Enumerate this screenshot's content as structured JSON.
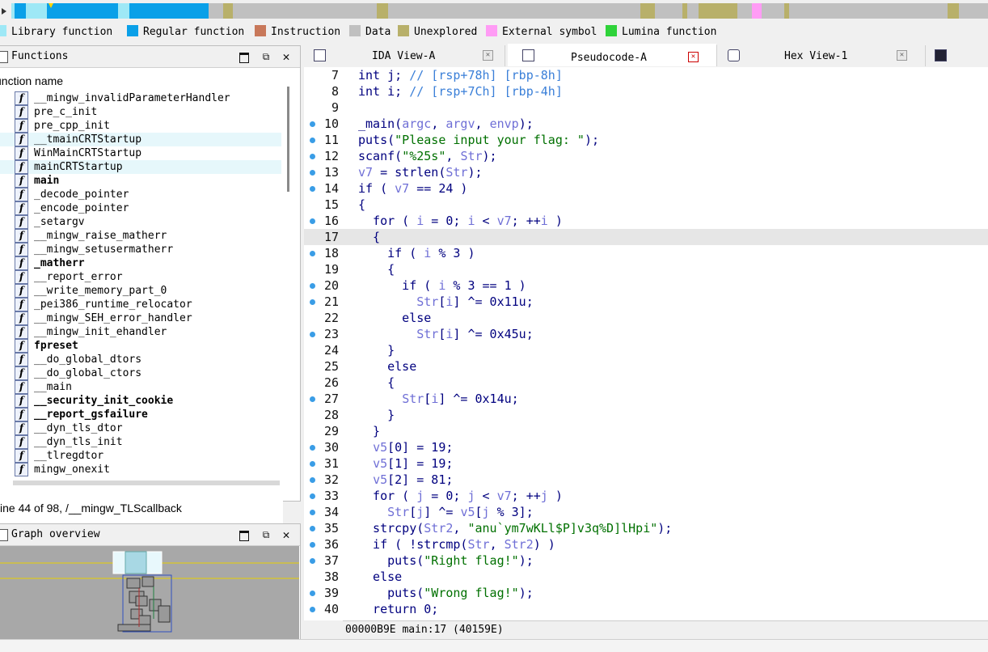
{
  "legend": [
    {
      "label": "Library function",
      "color": "#9ee8f6"
    },
    {
      "label": "Regular function",
      "color": "#0aa0e8"
    },
    {
      "label": "Instruction",
      "color": "#c8785a"
    },
    {
      "label": "Data",
      "color": "#c0c0c0"
    },
    {
      "label": "Unexplored",
      "color": "#b8b06a"
    },
    {
      "label": "External symbol",
      "color": "#ff9cf5"
    },
    {
      "label": "Lumina function",
      "color": "#2fd33a"
    }
  ],
  "functions_panel": {
    "title": "Functions",
    "column_header": "unction name",
    "items": [
      {
        "name": "__mingw_invalidParameterHandler",
        "bold": false,
        "selected": false
      },
      {
        "name": "pre_c_init",
        "bold": false,
        "selected": false
      },
      {
        "name": "pre_cpp_init",
        "bold": false,
        "selected": false
      },
      {
        "name": "__tmainCRTStartup",
        "bold": false,
        "selected": true
      },
      {
        "name": "WinMainCRTStartup",
        "bold": false,
        "selected": false
      },
      {
        "name": "mainCRTStartup",
        "bold": false,
        "selected": true
      },
      {
        "name": "main",
        "bold": true,
        "selected": false
      },
      {
        "name": "_decode_pointer",
        "bold": false,
        "selected": false
      },
      {
        "name": "_encode_pointer",
        "bold": false,
        "selected": false
      },
      {
        "name": "_setargv",
        "bold": false,
        "selected": false
      },
      {
        "name": "__mingw_raise_matherr",
        "bold": false,
        "selected": false
      },
      {
        "name": "__mingw_setusermatherr",
        "bold": false,
        "selected": false
      },
      {
        "name": "_matherr",
        "bold": true,
        "selected": false
      },
      {
        "name": "__report_error",
        "bold": false,
        "selected": false
      },
      {
        "name": "__write_memory_part_0",
        "bold": false,
        "selected": false
      },
      {
        "name": "_pei386_runtime_relocator",
        "bold": false,
        "selected": false
      },
      {
        "name": "__mingw_SEH_error_handler",
        "bold": false,
        "selected": false
      },
      {
        "name": "__mingw_init_ehandler",
        "bold": false,
        "selected": false
      },
      {
        "name": "fpreset",
        "bold": true,
        "selected": false
      },
      {
        "name": "__do_global_dtors",
        "bold": false,
        "selected": false
      },
      {
        "name": "__do_global_ctors",
        "bold": false,
        "selected": false
      },
      {
        "name": "__main",
        "bold": false,
        "selected": false
      },
      {
        "name": "__security_init_cookie",
        "bold": true,
        "selected": false
      },
      {
        "name": "__report_gsfailure",
        "bold": true,
        "selected": false
      },
      {
        "name": "__dyn_tls_dtor",
        "bold": false,
        "selected": false
      },
      {
        "name": "__dyn_tls_init",
        "bold": false,
        "selected": false
      },
      {
        "name": "__tlregdtor",
        "bold": false,
        "selected": false
      },
      {
        "name": "mingw_onexit",
        "bold": false,
        "selected": false
      }
    ],
    "status": "ine 44 of 98, /__mingw_TLScallback"
  },
  "graph_panel": {
    "title": "Graph overview"
  },
  "tabs": [
    {
      "label": "IDA View-A",
      "active": false
    },
    {
      "label": "Pseudocode-A",
      "active": true
    },
    {
      "label": "Hex View-1",
      "active": false
    }
  ],
  "code_lines": [
    {
      "n": "7",
      "bp": false,
      "hl": false,
      "html": "int j; <span class=\"cm\">// [rsp+78h] [rbp-8h]</span>"
    },
    {
      "n": "8",
      "bp": false,
      "hl": false,
      "html": "int i; <span class=\"cm\">// [rsp+7Ch] [rbp-4h]</span>"
    },
    {
      "n": "9",
      "bp": false,
      "hl": false,
      "html": ""
    },
    {
      "n": "10",
      "bp": true,
      "hl": false,
      "html": "_main(<span class=\"var\">argc</span>, <span class=\"var\">argv</span>, <span class=\"var\">envp</span>);"
    },
    {
      "n": "11",
      "bp": true,
      "hl": false,
      "html": "puts(<span class=\"str\">\"Please input your flag: \"</span>);"
    },
    {
      "n": "12",
      "bp": true,
      "hl": false,
      "html": "scanf(<span class=\"str\">\"%25s\"</span>, <span class=\"var\">Str</span>);"
    },
    {
      "n": "13",
      "bp": true,
      "hl": false,
      "html": "<span class=\"var\">v7</span> = strlen(<span class=\"var\">Str</span>);"
    },
    {
      "n": "14",
      "bp": true,
      "hl": false,
      "html": "if ( <span class=\"var\">v7</span> == 24 )"
    },
    {
      "n": "15",
      "bp": false,
      "hl": false,
      "html": "{"
    },
    {
      "n": "16",
      "bp": true,
      "hl": false,
      "html": "  for ( <span class=\"var\">i</span> = 0; <span class=\"var\">i</span> &lt; <span class=\"var\">v7</span>; ++<span class=\"var\">i</span> )"
    },
    {
      "n": "17",
      "bp": false,
      "hl": true,
      "html": "  {"
    },
    {
      "n": "18",
      "bp": true,
      "hl": false,
      "html": "    if ( <span class=\"var\">i</span> % 3 )"
    },
    {
      "n": "19",
      "bp": false,
      "hl": false,
      "html": "    {"
    },
    {
      "n": "20",
      "bp": true,
      "hl": false,
      "html": "      if ( <span class=\"var\">i</span> % 3 == 1 )"
    },
    {
      "n": "21",
      "bp": true,
      "hl": false,
      "html": "        <span class=\"var\">Str</span>[<span class=\"var\">i</span>] ^= 0x11u;"
    },
    {
      "n": "22",
      "bp": false,
      "hl": false,
      "html": "      else"
    },
    {
      "n": "23",
      "bp": true,
      "hl": false,
      "html": "        <span class=\"var\">Str</span>[<span class=\"var\">i</span>] ^= 0x45u;"
    },
    {
      "n": "24",
      "bp": false,
      "hl": false,
      "html": "    }"
    },
    {
      "n": "25",
      "bp": false,
      "hl": false,
      "html": "    else"
    },
    {
      "n": "26",
      "bp": false,
      "hl": false,
      "html": "    {"
    },
    {
      "n": "27",
      "bp": true,
      "hl": false,
      "html": "      <span class=\"var\">Str</span>[<span class=\"var\">i</span>] ^= 0x14u;"
    },
    {
      "n": "28",
      "bp": false,
      "hl": false,
      "html": "    }"
    },
    {
      "n": "29",
      "bp": false,
      "hl": false,
      "html": "  }"
    },
    {
      "n": "30",
      "bp": true,
      "hl": false,
      "html": "  <span class=\"var\">v5</span>[0] = 19;"
    },
    {
      "n": "31",
      "bp": true,
      "hl": false,
      "html": "  <span class=\"var\">v5</span>[1] = 19;"
    },
    {
      "n": "32",
      "bp": true,
      "hl": false,
      "html": "  <span class=\"var\">v5</span>[2] = 81;"
    },
    {
      "n": "33",
      "bp": true,
      "hl": false,
      "html": "  for ( <span class=\"var\">j</span> = 0; <span class=\"var\">j</span> &lt; <span class=\"var\">v7</span>; ++<span class=\"var\">j</span> )"
    },
    {
      "n": "34",
      "bp": true,
      "hl": false,
      "html": "    <span class=\"var\">Str</span>[<span class=\"var\">j</span>] ^= <span class=\"var\">v5</span>[<span class=\"var\">j</span> % 3];"
    },
    {
      "n": "35",
      "bp": true,
      "hl": false,
      "html": "  strcpy(<span class=\"var\">Str2</span>, <span class=\"str\">\"anu`ym7wKLl$P]v3q%D]lHpi\"</span>);"
    },
    {
      "n": "36",
      "bp": true,
      "hl": false,
      "html": "  if ( !strcmp(<span class=\"var\">Str</span>, <span class=\"var\">Str2</span>) )"
    },
    {
      "n": "37",
      "bp": true,
      "hl": false,
      "html": "    puts(<span class=\"str\">\"Right flag!\"</span>);"
    },
    {
      "n": "38",
      "bp": false,
      "hl": false,
      "html": "  else"
    },
    {
      "n": "39",
      "bp": true,
      "hl": false,
      "html": "    puts(<span class=\"str\">\"Wrong flag!\"</span>);"
    },
    {
      "n": "40",
      "bp": true,
      "hl": false,
      "html": "  return 0;"
    }
  ],
  "status_bar": "00000B9E main:17 (40159E)"
}
